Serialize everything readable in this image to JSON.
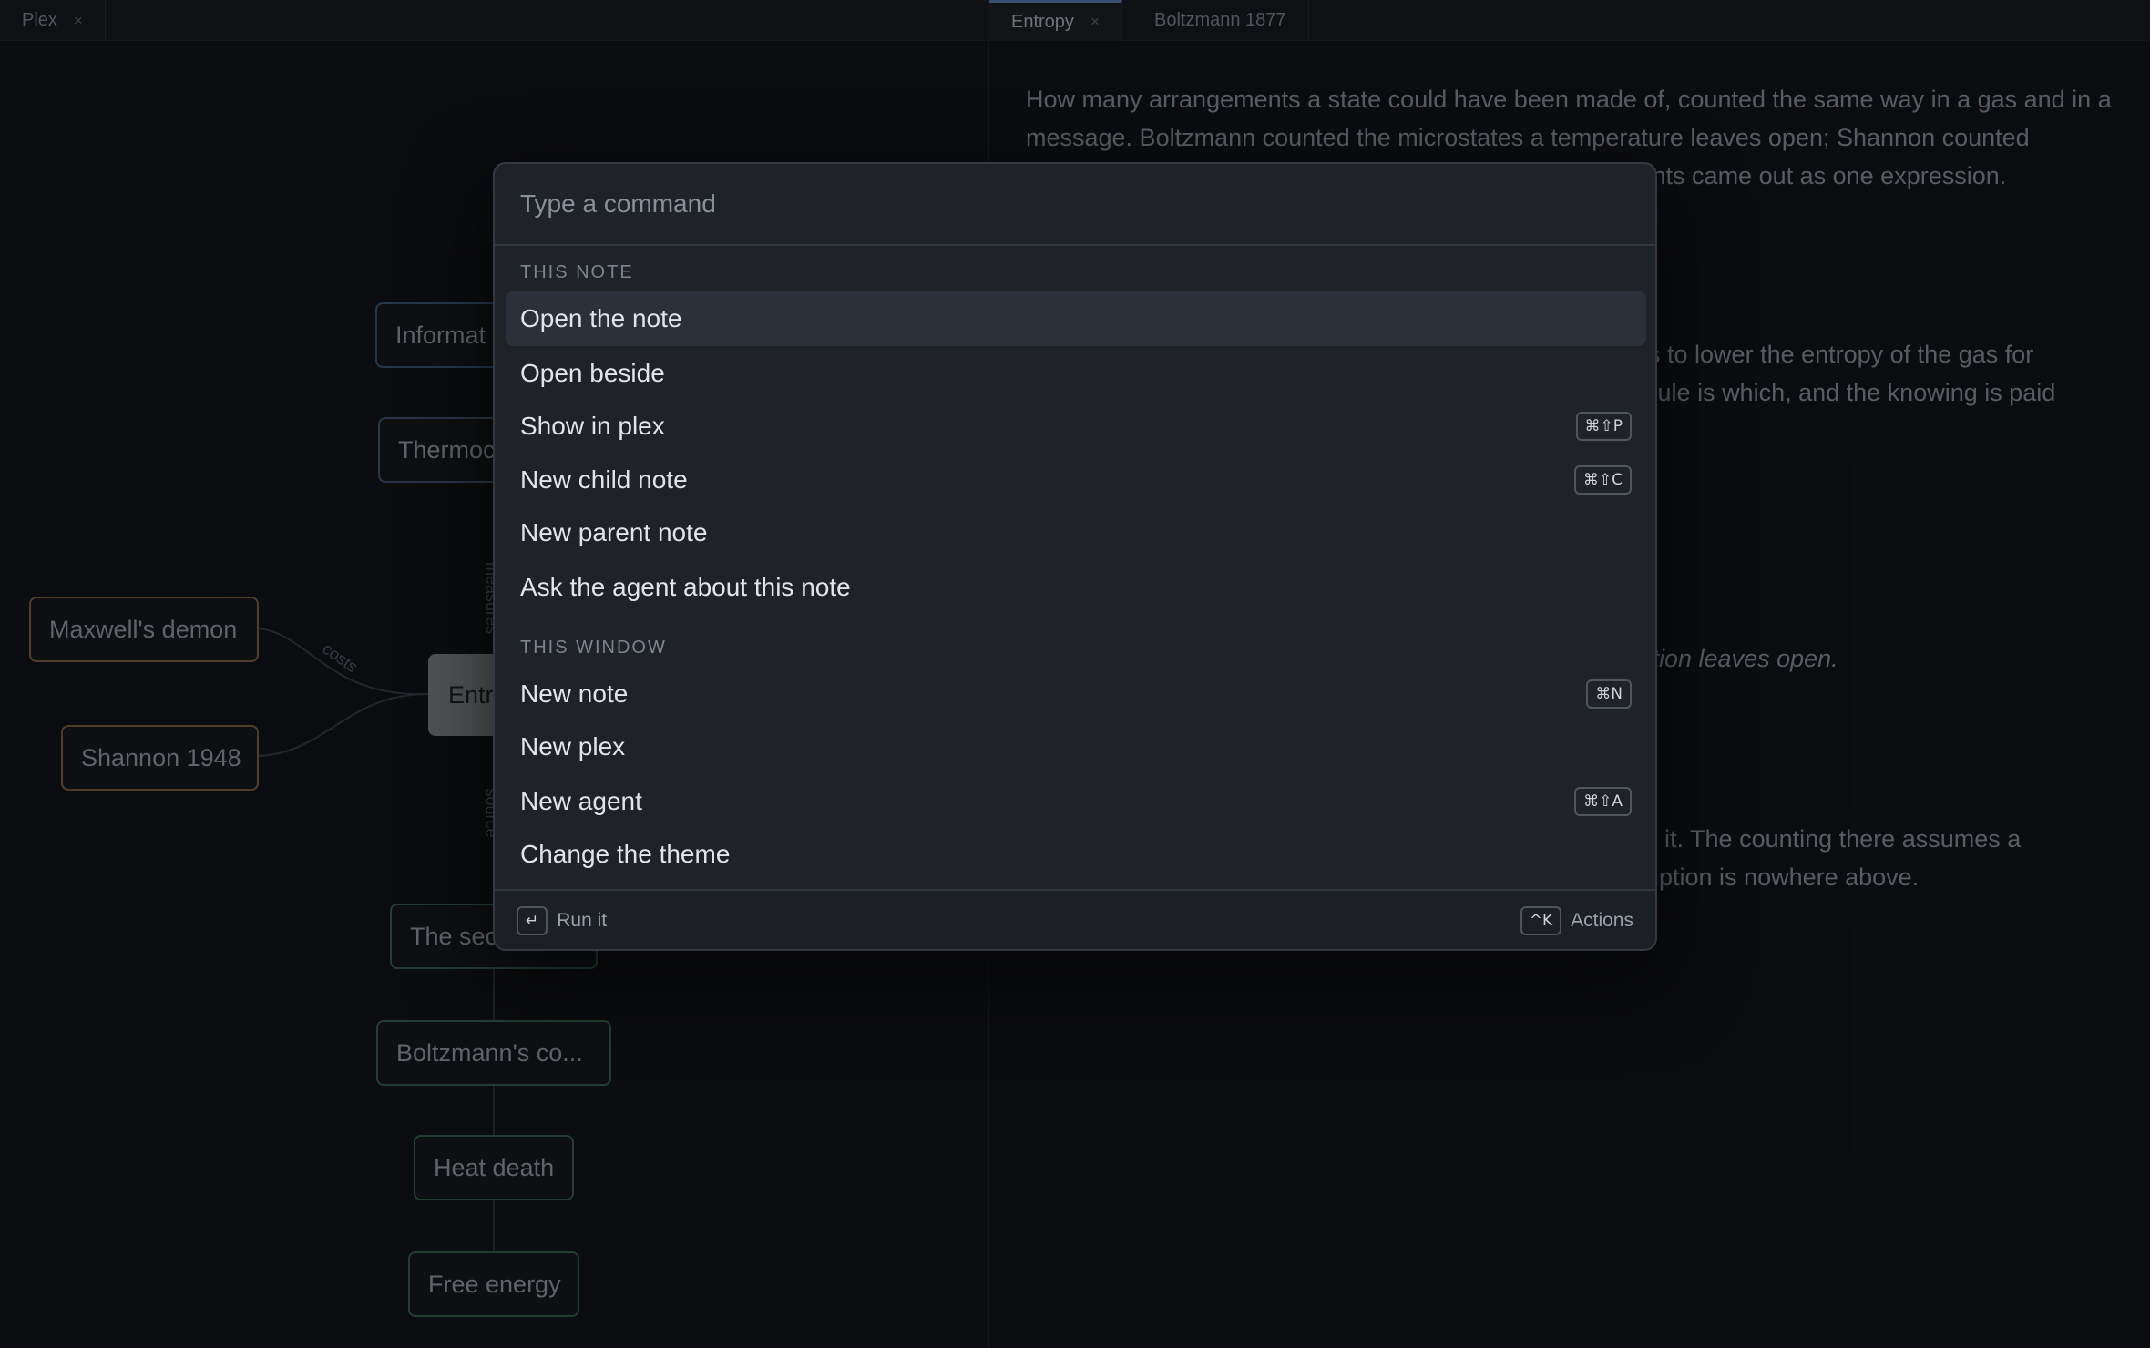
{
  "left_tabs": [
    {
      "label": "Plex",
      "close": "×"
    }
  ],
  "right_tabs": [
    {
      "label": "Entropy",
      "close": "×"
    },
    {
      "label": "Boltzmann 1877"
    }
  ],
  "graph": {
    "nodes": {
      "information": "Informat",
      "thermodynamics": "Thermoc",
      "maxwell": "Maxwell's demon",
      "shannon": "Shannon 1948",
      "entropy": "Entr",
      "second_law": "The sec",
      "boltzmann": "Boltzmann's co...",
      "heat_death": "Heat death",
      "free_energy": "Free energy"
    },
    "edge_labels": {
      "costs": "costs",
      "measures": "measures",
      "source": "source"
    }
  },
  "note": {
    "para1": "How many arrangements a state could have been made of, counted the same way in a gas and in a message. Boltzmann counted the microstates a temperature leaves open; Shannon counted",
    "para1_tail": "counts came out as one expression.",
    "para2_line1": "ears to lower the entropy of the gas for",
    "para2_line2": "olecule is which, and the knowing is paid",
    "para3": "cription leaves open.",
    "para4_line1": "side it. The counting there assumes a",
    "para4_line2": "sumption is nowhere above."
  },
  "palette": {
    "placeholder": "Type a command",
    "sections": [
      {
        "title": "THIS NOTE",
        "items": [
          {
            "label": "Open the note",
            "selected": true
          },
          {
            "label": "Open beside"
          },
          {
            "label": "Show in plex",
            "shortcut": "⌘⇧P"
          },
          {
            "label": "New child note",
            "shortcut": "⌘⇧C"
          },
          {
            "label": "New parent note"
          },
          {
            "label": "Ask the agent about this note"
          }
        ]
      },
      {
        "title": "THIS WINDOW",
        "items": [
          {
            "label": "New note",
            "shortcut": "⌘N"
          },
          {
            "label": "New plex"
          },
          {
            "label": "New agent",
            "shortcut": "⌘⇧A"
          },
          {
            "label": "Change the theme"
          }
        ]
      }
    ],
    "footer": {
      "run_key": "↵",
      "run_label": "Run it",
      "actions_key": "^K",
      "actions_label": "Actions"
    }
  },
  "colors": {
    "accent": "#5c86c4",
    "node_blue": "#3f5e80",
    "node_orange": "#8a6a40",
    "node_green": "#3a6a50"
  }
}
